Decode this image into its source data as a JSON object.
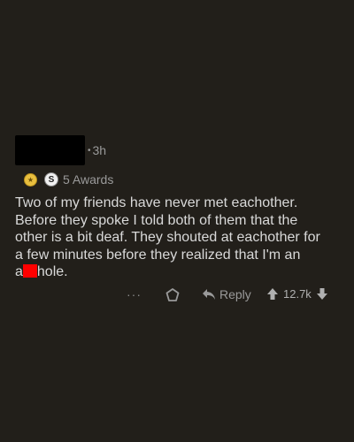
{
  "comment": {
    "meta_separator": "•",
    "timestamp": "3h",
    "awards": {
      "count_label": "5 Awards",
      "silver_icon_letter": "S"
    },
    "body_lines": [
      "Two of my friends have never met eachother.",
      "Before they spoke I told both of them that the",
      "other is a bit deaf. They shouted at eachother for",
      "a few minutes before they realized that I'm an"
    ],
    "last_line_prefix": "a",
    "last_line_suffix": "hole."
  },
  "actions": {
    "more_label": "···",
    "reply_label": "Reply",
    "score": "12.7k"
  },
  "colors": {
    "background": "#221f1a",
    "text": "#d9d9d9",
    "muted": "#9a9a9a",
    "redaction_username": "#000000",
    "redaction_word": "#ff0000"
  },
  "icons": {
    "award": "award-icon",
    "reply": "reply-arrow-icon",
    "upvote": "upvote-arrow-icon",
    "downvote": "downvote-arrow-icon",
    "give_award": "give-award-icon"
  }
}
